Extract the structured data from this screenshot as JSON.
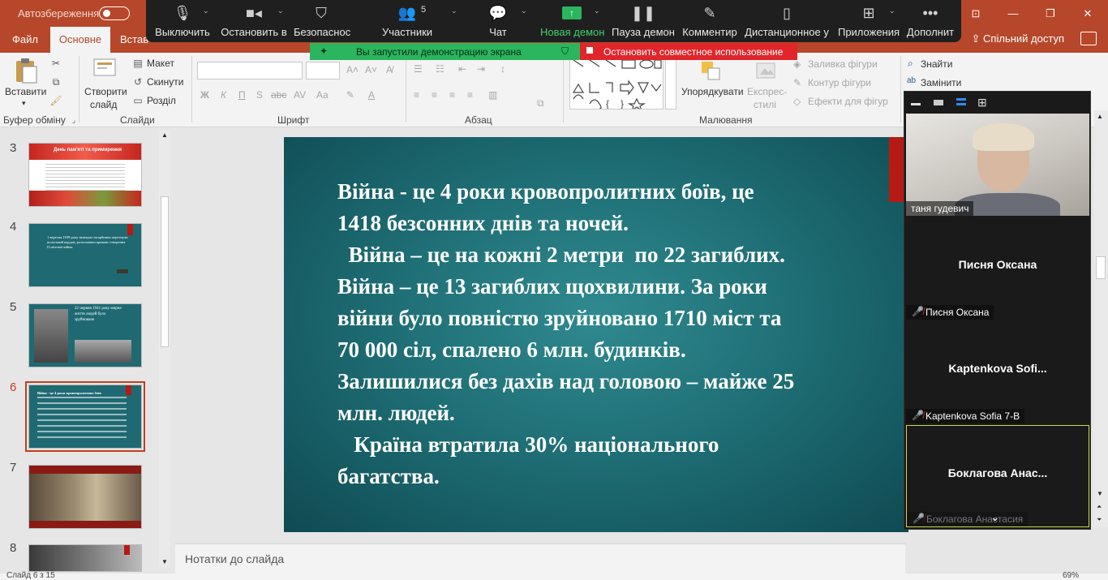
{
  "titlebar": {
    "autosave_label": "Автозбереження",
    "window_controls": {
      "ribbon_display": "⊡",
      "minimize": "—",
      "restore": "❐",
      "close": "✕"
    }
  },
  "tabs": {
    "file": "Файл",
    "home": "Основне",
    "insert": "Встав",
    "share": "Спільний доступ"
  },
  "zoom_toolbar": {
    "items": [
      {
        "label": "Выключить",
        "icon": "microphone-icon"
      },
      {
        "label": "Остановить в",
        "icon": "video-camera-icon"
      },
      {
        "label": "Безопаснос",
        "icon": "shield-icon"
      },
      {
        "label": "Участники",
        "icon": "participants-icon",
        "count": "5"
      },
      {
        "label": "Чат",
        "icon": "chat-icon"
      },
      {
        "label": "Новая демон",
        "icon": "share-screen-icon"
      },
      {
        "label": "Пауза демон",
        "icon": "pause-icon"
      },
      {
        "label": "Комментир",
        "icon": "pencil-icon"
      },
      {
        "label": "Дистанционное у",
        "icon": "mouse-icon"
      },
      {
        "label": "Приложения",
        "icon": "apps-icon"
      },
      {
        "label": "Дополнит",
        "icon": "more-icon"
      }
    ],
    "share_banner": "Вы запустили демонстрацию экрана",
    "stop_banner": "Остановить совместное использование",
    "accent": "#2bb55e",
    "stop_color": "#e0262b"
  },
  "ribbon": {
    "clipboard": {
      "paste": "Вставити",
      "label": "Буфер обміну"
    },
    "slides": {
      "new_slide_line1": "Створити",
      "new_slide_line2": "слайд",
      "layout": "Макет",
      "reset": "Скинути",
      "section": "Розділ",
      "label": "Слайди"
    },
    "font": {
      "label": "Шрифт",
      "bold": "Ж",
      "italic": "К",
      "underline": "П",
      "strike": "abc",
      "spacing": "AV",
      "case": "Aa"
    },
    "paragraph": {
      "label": "Абзац"
    },
    "drawing": {
      "arrange": "Упорядкувати",
      "quick_styles_line1": "Експрес-",
      "quick_styles_line2": "стилі",
      "shape_fill": "Заливка фігури",
      "shape_outline": "Контур фігури",
      "shape_effects": "Ефекти для фігур",
      "label": "Малювання"
    },
    "editing": {
      "find": "Знайти",
      "replace": "Замінити"
    }
  },
  "thumbnails": [
    {
      "num": "3",
      "title": "День пам'яті та примирення"
    },
    {
      "num": "4",
      "title": "1 вересня 1939 року німецькі загарбники перетнули польський кордон, розпочавши кривавє створення ІІ світової війни."
    },
    {
      "num": "5",
      "title": "22 червня 1941 року мирне життя людей було зруйноване"
    },
    {
      "num": "6",
      "title": "Війна - це 4 роки кровопролитних боїв"
    },
    {
      "num": "7",
      "title": ""
    },
    {
      "num": "8",
      "title": ""
    }
  ],
  "slide": {
    "lines": [
      "Війна - це  4 роки кровопролитних боїв, це",
      "1418 безсонних днів та ночей.",
      "  Війна – це на кожні 2 метри  по 22 загиблих.",
      "Війна – це  13 загиблих щохвилини. За роки",
      "війни було повністю зруйновано 1710 міст та",
      "70 000 сіл, спалено 6 млн. будинків.",
      "Залишилися без дахів над головою – майже 25",
      "млн. людей.",
      "   Країна втратила 30% національного",
      "багатства."
    ]
  },
  "notes_placeholder": "Нотатки до слайда",
  "gallery": {
    "self_video_name": "таня гудевич",
    "tiles": [
      {
        "center_name": "Писня Оксана",
        "tag": "Писня Оксана"
      },
      {
        "center_name": "Kaptenkova  Sofi...",
        "tag": "Kaptenkova Sofia 7-B"
      },
      {
        "center_name": "Боклагова  Анас...",
        "tag": "Боклагова Анастасия"
      }
    ]
  },
  "status": {
    "slide_of": "Слайд 6 з 15",
    "zoom": "69%"
  }
}
